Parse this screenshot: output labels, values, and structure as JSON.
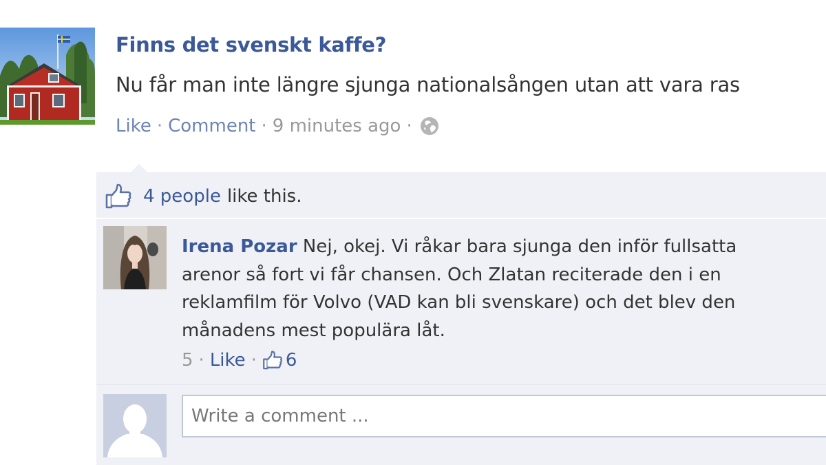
{
  "post": {
    "title": "Finns det svenskt kaffe?",
    "body": "Nu får man inte längre sjunga nationalsången utan att vara ras",
    "actions": {
      "like": "Like",
      "comment": "Comment",
      "timestamp": "9 minutes ago",
      "separator": "·",
      "privacy_icon": "globe-icon"
    }
  },
  "likes": {
    "icon": "thumbs-up-icon",
    "people": "4 people",
    "suffix": "like this."
  },
  "comment": {
    "author": "Irena Pozar",
    "lines": [
      "Nej, okej. Vi råkar bara sjunga den inför fullsatta",
      "arenor så fort vi får chansen. Och Zlatan reciterade den i en",
      "reklamfilm för Volvo (VAD kan bli svenskare) och det blev den",
      "månadens mest populära låt."
    ],
    "meta": {
      "time": "5",
      "like": "Like",
      "like_count": "6",
      "separator": "·"
    }
  },
  "compose": {
    "placeholder": "Write a comment ..."
  },
  "colors": {
    "link": "#3b5998",
    "muted": "#999999",
    "feedback_bg": "#eff1f6"
  }
}
